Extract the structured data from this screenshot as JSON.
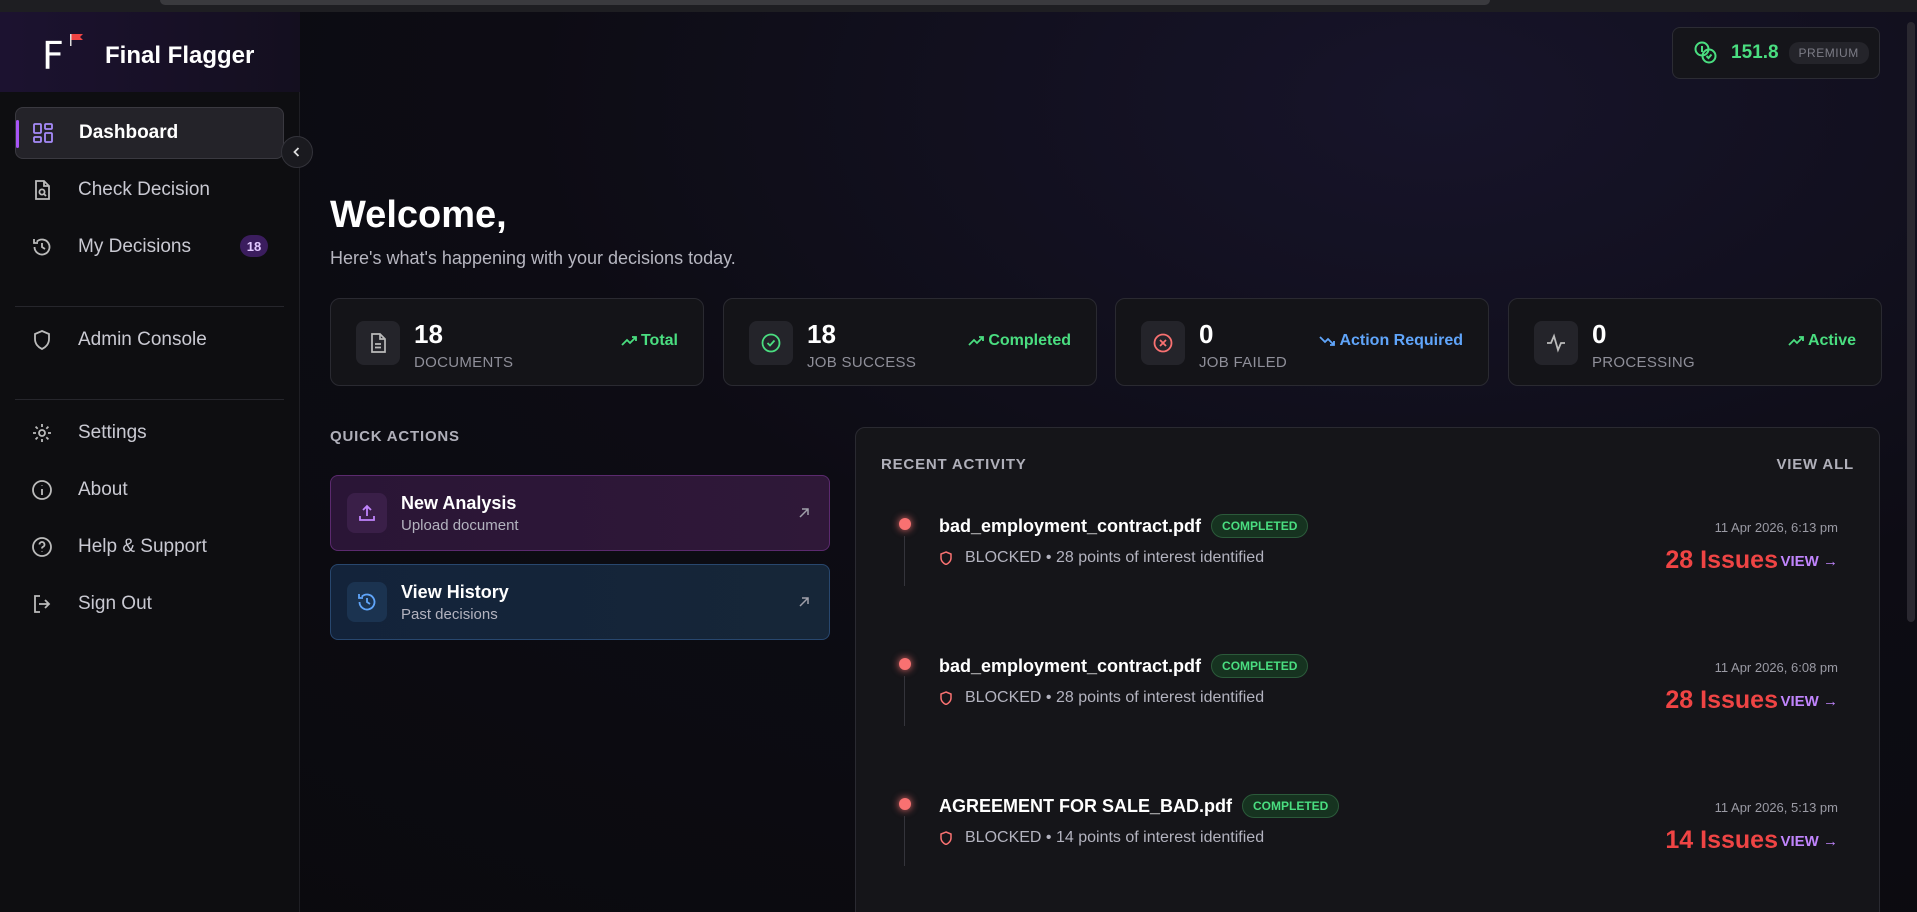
{
  "app": {
    "name": "Final Flagger",
    "logo_letter": "F"
  },
  "credits": {
    "amount": "151.8",
    "tier": "PREMIUM"
  },
  "sidebar": {
    "items": [
      {
        "label": "Dashboard"
      },
      {
        "label": "Check Decision"
      },
      {
        "label": "My Decisions",
        "badge": "18"
      },
      {
        "label": "Admin Console"
      },
      {
        "label": "Settings"
      },
      {
        "label": "About"
      },
      {
        "label": "Help & Support"
      },
      {
        "label": "Sign Out"
      }
    ]
  },
  "main": {
    "title": "Welcome,",
    "subtitle": "Here's what's happening with your decisions today."
  },
  "stats": [
    {
      "value": "18",
      "caption": "DOCUMENTS",
      "trend": "Total",
      "color": "#4ade80"
    },
    {
      "value": "18",
      "caption": "JOB SUCCESS",
      "trend": "Completed",
      "color": "#4ade80"
    },
    {
      "value": "0",
      "caption": "JOB FAILED",
      "trend": "Action Required",
      "color": "#60a5fa"
    },
    {
      "value": "0",
      "caption": "PROCESSING",
      "trend": "Active",
      "color": "#4ade80"
    }
  ],
  "quick_actions": {
    "title": "QUICK ACTIONS",
    "items": [
      {
        "title": "New Analysis",
        "subtitle": "Upload document"
      },
      {
        "title": "View History",
        "subtitle": "Past decisions"
      }
    ]
  },
  "activity": {
    "title": "RECENT ACTIVITY",
    "view_all": "VIEW ALL",
    "items": [
      {
        "file": "bad_employment_contract.pdf",
        "status": "COMPLETED",
        "meta": "BLOCKED • 28 points of interest identified",
        "time": "11 Apr 2026, 6:13 pm",
        "issues": "28 Issues",
        "view": "VIEW →"
      },
      {
        "file": "bad_employment_contract.pdf",
        "status": "COMPLETED",
        "meta": "BLOCKED • 28 points of interest identified",
        "time": "11 Apr 2026, 6:08 pm",
        "issues": "28 Issues",
        "view": "VIEW →"
      },
      {
        "file": "AGREEMENT FOR SALE_BAD.pdf",
        "status": "COMPLETED",
        "meta": "BLOCKED • 14 points of interest identified",
        "time": "11 Apr 2026, 5:13 pm",
        "issues": "14 Issues",
        "view": "VIEW →"
      }
    ]
  },
  "colors": {
    "accent": "#a855f7",
    "success": "#4ade80",
    "danger": "#ef4444",
    "info": "#60a5fa"
  }
}
